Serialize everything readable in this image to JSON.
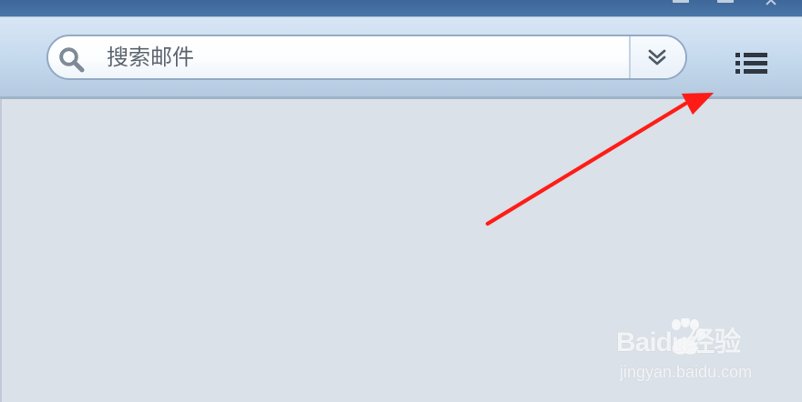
{
  "search": {
    "placeholder": "搜索邮件"
  },
  "icons": {
    "search": "search-icon",
    "expand": "chevron-down-icon",
    "menu": "list-icon",
    "watermark_logo": "baidu-paw-icon"
  },
  "watermark": {
    "brand_text": "Baidu经验",
    "url": "jingyan.baidu.com"
  },
  "colors": {
    "annotation_arrow": "#ff1a12",
    "toolbar_blue": "#c7dbef",
    "title_blue": "#4a76a8",
    "content_bg": "#dbe1e8"
  }
}
